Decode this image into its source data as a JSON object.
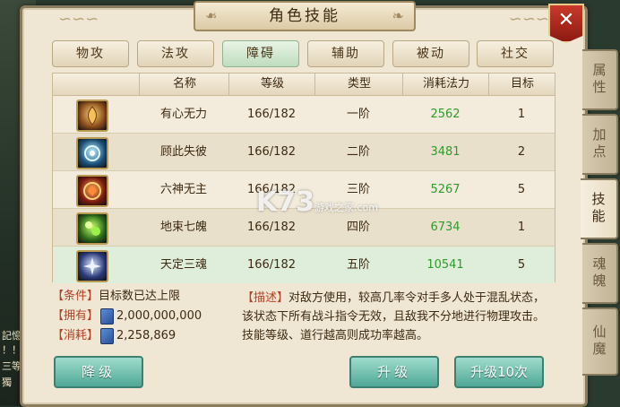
{
  "window": {
    "title": "角色技能",
    "close_label": "✕"
  },
  "background_scraps": [
    "記憶",
    "！！",
    "三等",
    "獨"
  ],
  "categories": [
    {
      "label": "物攻",
      "active": false
    },
    {
      "label": "法攻",
      "active": false
    },
    {
      "label": "障碍",
      "active": true
    },
    {
      "label": "辅助",
      "active": false
    },
    {
      "label": "被动",
      "active": false
    },
    {
      "label": "社交",
      "active": false
    }
  ],
  "table": {
    "headers": {
      "icon": "",
      "name": "名称",
      "level": "等级",
      "type": "类型",
      "cost": "消耗法力",
      "target": "目标"
    },
    "rows": [
      {
        "name": "有心无力",
        "level": "166/182",
        "type": "一阶",
        "cost": "2562",
        "target": "1"
      },
      {
        "name": "顾此失彼",
        "level": "166/182",
        "type": "二阶",
        "cost": "3481",
        "target": "2"
      },
      {
        "name": "六神无主",
        "level": "166/182",
        "type": "三阶",
        "cost": "5267",
        "target": "5"
      },
      {
        "name": "地束七魄",
        "level": "166/182",
        "type": "四阶",
        "cost": "6734",
        "target": "1"
      },
      {
        "name": "天定三魂",
        "level": "166/182",
        "type": "五阶",
        "cost": "10541",
        "target": "5"
      }
    ],
    "selected_index": 4
  },
  "info": {
    "condition_tag": "【条件】",
    "condition_text": "目标数已达上限",
    "own_tag": "【拥有】",
    "own_value": "2,000,000,000",
    "cost_tag": "【消耗】",
    "cost_value": "2,258,869"
  },
  "description": {
    "tag": "【描述】",
    "text": "对敌方使用，较高几率令对手多人处于混乱状态，该状态下所有战斗指令无效，且敌我不分地进行物理攻击。技能等级、道行越高则成功率越高。"
  },
  "buttons": {
    "downgrade": "降级",
    "upgrade": "升级",
    "upgrade_ten": "升级10次"
  },
  "side_tabs": [
    {
      "label": "属性",
      "active": false
    },
    {
      "label": "加点",
      "active": false
    },
    {
      "label": "技能",
      "active": true
    },
    {
      "label": "魂魄",
      "active": false
    },
    {
      "label": "仙魔",
      "active": false
    }
  ],
  "watermark": {
    "main": "K73",
    "sub": "游戏之家",
    "domain": ".com"
  },
  "colors": {
    "cost_green": "#2e9b2a",
    "tag_red": "#b0432a",
    "close_red": "#c93a2a",
    "button_teal": "#4fa896"
  }
}
